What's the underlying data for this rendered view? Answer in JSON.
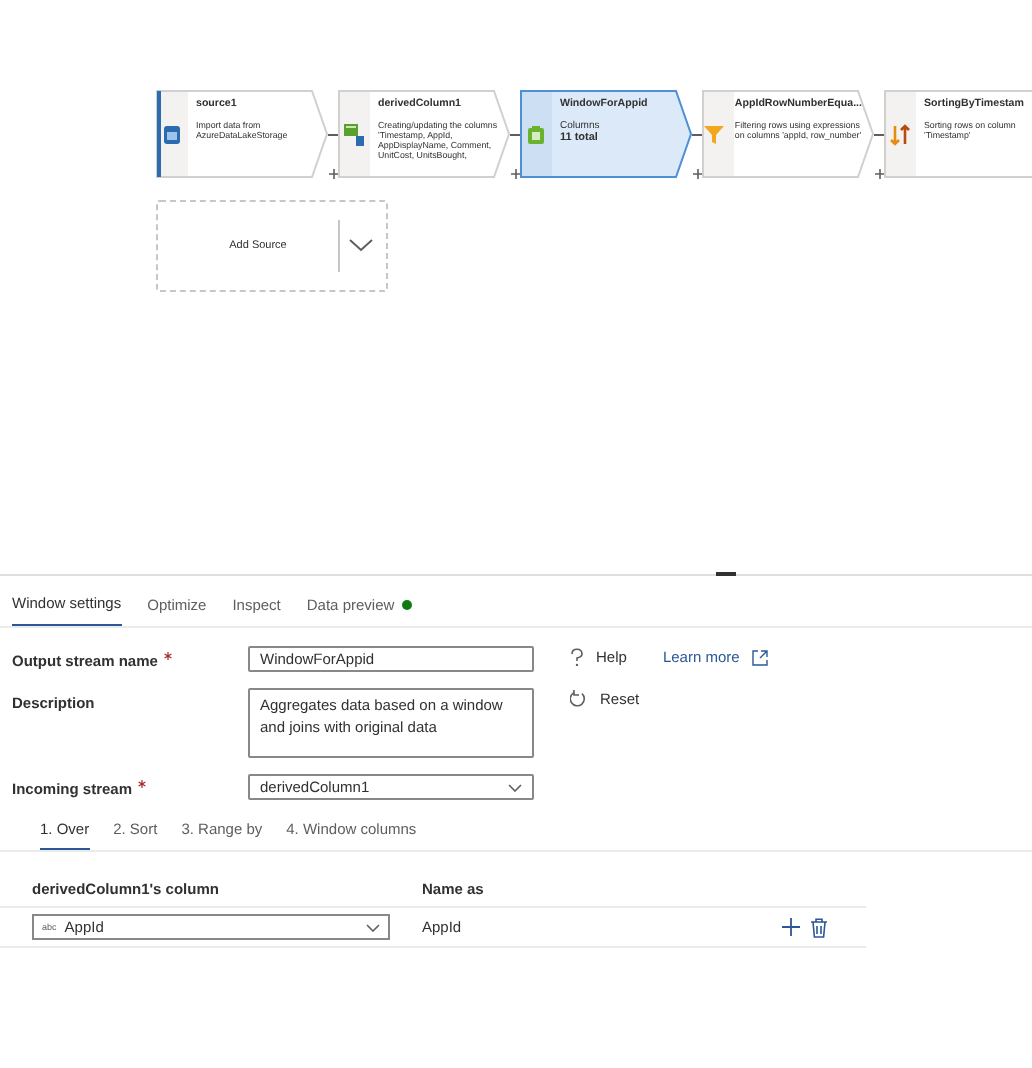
{
  "canvas": {
    "nodes": [
      {
        "kind": "source",
        "title": "source1",
        "description": "Import data from AzureDataLakeStorage",
        "selected": false
      },
      {
        "kind": "derived",
        "title": "derivedColumn1",
        "description": "Creating/updating the columns 'Timestamp, AppId, AppDisplayName, Comment, UnitCost, UnitsBought,",
        "selected": false
      },
      {
        "kind": "window",
        "title": "WindowForAppid",
        "footer_label": "Columns",
        "footer_value": "11 total",
        "selected": true
      },
      {
        "kind": "filter",
        "title": "AppIdRowNumberEqua...",
        "description": "Filtering rows using expressions on columns 'appId, row_number'",
        "selected": false
      },
      {
        "kind": "sort",
        "title": "SortingByTimestam",
        "description": "Sorting rows on column 'Timestamp'",
        "selected": false
      }
    ],
    "add_source": {
      "label": "Add Source"
    }
  },
  "panel": {
    "tabs": [
      {
        "label": "Window settings",
        "selected": true
      },
      {
        "label": "Optimize",
        "selected": false
      },
      {
        "label": "Inspect",
        "selected": false
      },
      {
        "label": "Data preview",
        "selected": false,
        "indicator": true
      }
    ],
    "output_stream_name": {
      "label": "Output stream name",
      "required": true,
      "value": "WindowForAppid"
    },
    "description": {
      "label": "Description",
      "value": "Aggregates data based on a window and joins with original data"
    },
    "incoming_stream": {
      "label": "Incoming stream",
      "required": true,
      "value": "derivedColumn1"
    },
    "help": {
      "label": "Help"
    },
    "learn_more": {
      "label": "Learn more"
    },
    "reset": {
      "label": "Reset"
    },
    "steps": [
      {
        "label": "1. Over",
        "selected": true
      },
      {
        "label": "2. Sort",
        "selected": false
      },
      {
        "label": "3. Range by",
        "selected": false
      },
      {
        "label": "4. Window columns",
        "selected": false
      }
    ],
    "over_table": {
      "columns": [
        "derivedColumn1's column",
        "Name as"
      ],
      "rows": [
        {
          "type": "abc",
          "column": "AppId",
          "name_as": "AppId"
        }
      ]
    }
  }
}
